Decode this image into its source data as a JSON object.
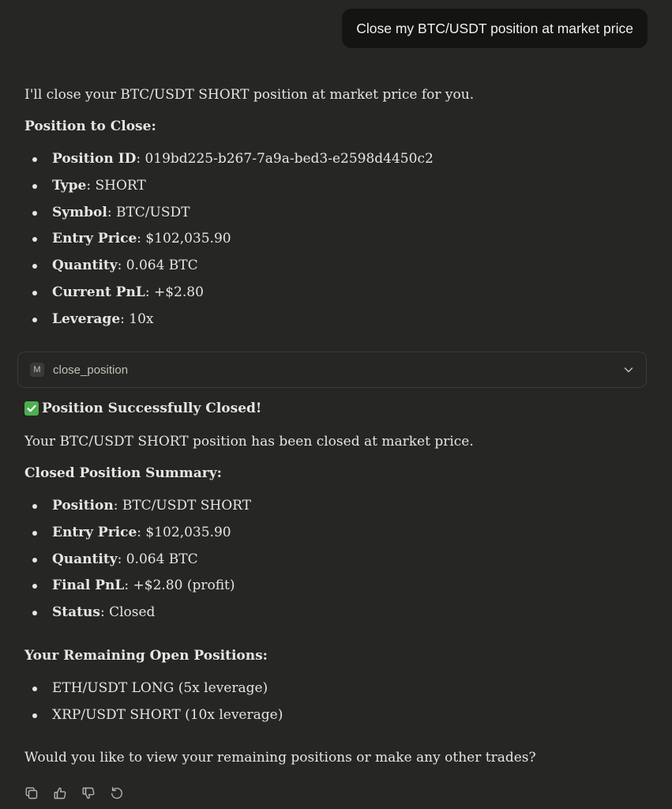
{
  "user_message": "Close my BTC/USDT position at market price",
  "assistant": {
    "intro": "I'll close your BTC/USDT SHORT position at market price for you.",
    "to_close_heading": "Position to Close:",
    "to_close_items": [
      {
        "key": "Position ID",
        "value": ": 019bd225-b267-7a9a-bed3-e2598d4450c2"
      },
      {
        "key": "Type",
        "value": ": SHORT"
      },
      {
        "key": "Symbol",
        "value": ": BTC/USDT"
      },
      {
        "key": "Entry Price",
        "value": ": $102,035.90"
      },
      {
        "key": "Quantity",
        "value": ": 0.064 BTC"
      },
      {
        "key": "Current PnL",
        "value": ": +$2.80"
      },
      {
        "key": "Leverage",
        "value": ": 10x"
      }
    ],
    "tool": {
      "badge": "M",
      "name": "close_position",
      "icon": "chevron-down-icon"
    },
    "success_icon": "check-mark-icon",
    "success_heading": "Position Successfully Closed!",
    "closed_text": "Your BTC/USDT SHORT position has been closed at market price.",
    "summary_heading": "Closed Position Summary:",
    "summary_items": [
      {
        "key": "Position",
        "value": ": BTC/USDT SHORT"
      },
      {
        "key": "Entry Price",
        "value": ": $102,035.90"
      },
      {
        "key": "Quantity",
        "value": ": 0.064 BTC"
      },
      {
        "key": "Final PnL",
        "value": ": +$2.80 (profit)"
      },
      {
        "key": "Status",
        "value": ": Closed"
      }
    ],
    "remaining_heading": "Your Remaining Open Positions:",
    "remaining_items": [
      "ETH/USDT LONG (5x leverage)",
      "XRP/USDT SHORT (10x leverage)"
    ],
    "closing_question": "Would you like to view your remaining positions or make any other trades?"
  },
  "actions": [
    "copy-icon",
    "thumbs-up-icon",
    "thumbs-down-icon",
    "retry-icon"
  ],
  "colors": {
    "background": "#262624",
    "user_bubble": "#141413",
    "text": "#e8e6e1",
    "check_green": "#4caf50"
  }
}
